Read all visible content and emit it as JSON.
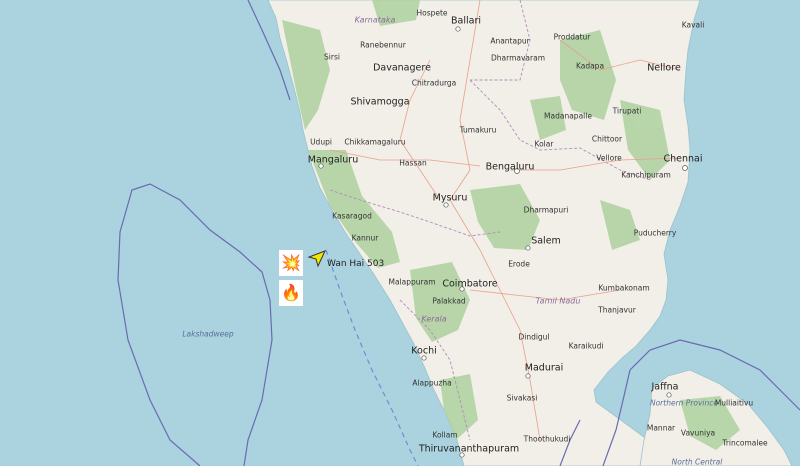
{
  "vessel": {
    "name": "Wan Hai 503",
    "heading_icon": "navigation-arrow-icon",
    "color": "#f2e600"
  },
  "incident_markers": [
    {
      "icon": "explosion-icon",
      "glyph": "💥"
    },
    {
      "icon": "fire-icon",
      "glyph": "🔥"
    }
  ],
  "colors": {
    "sea": "#aad3df",
    "land": "#f2efe9",
    "forest": "#add19e",
    "boundary": "#6a6ab0"
  },
  "labels": {
    "hospete": "Hospete",
    "ballari": "Ballari",
    "karnataka": "Karnataka",
    "kavali": "Kavali",
    "ranebennur": "Ranebennur",
    "anantapur": "Anantapur",
    "proddatur": "Proddatur",
    "sirsi": "Sirsi",
    "davanagere": "Davanagere",
    "dharmavaram": "Dharmavaram",
    "kadapa": "Kadapa",
    "nellore": "Nellore",
    "chitradurga": "Chitradurga",
    "shivamogga": "Shivamogga",
    "tirupati": "Tirupati",
    "madanapalle": "Madanapalle",
    "udupi": "Udupi",
    "tumakuru": "Tumakuru",
    "chikkamagaluru": "Chikkamagaluru",
    "chittoor": "Chittoor",
    "mangaluru": "Mangaluru",
    "kolar": "Kolar",
    "hassan": "Hassan",
    "bengaluru": "Bengaluru",
    "vellore": "Vellore",
    "chennai": "Chennai",
    "kanchipuram": "Kanchipuram",
    "mysuru": "Mysuru",
    "dharmapuri": "Dharmapuri",
    "kasaragod": "Kasaragod",
    "salem": "Salem",
    "kannur": "Kannur",
    "puducherry": "Puducherry",
    "erode": "Erode",
    "malappuram": "Malappuram",
    "coimbatore": "Coimbatore",
    "kumbakonam": "Kumbakonam",
    "tamil_nadu": "Tamil Nadu",
    "palakkad": "Palakkad",
    "thanjavur": "Thanjavur",
    "lakshadweep": "Lakshadweep",
    "kerala": "Kerala",
    "dindigul": "Dindigul",
    "kochi": "Kochi",
    "karaikudi": "Karaikudi",
    "madurai": "Madurai",
    "alappuzha": "Alappuzha",
    "jaffna": "Jaffna",
    "sivakasi": "Sivakasi",
    "northern_province": "Northern Province",
    "mullaitivu": "Mulliaitivu",
    "mannar": "Mannar",
    "vavuniya": "Vavuniya",
    "trincomalee": "Trincomalee",
    "kollam": "Kollam",
    "thoothukudi": "Thoothukudi",
    "thiruvananthapuram": "Thiruvananthapuram",
    "north_central": "North Central"
  }
}
